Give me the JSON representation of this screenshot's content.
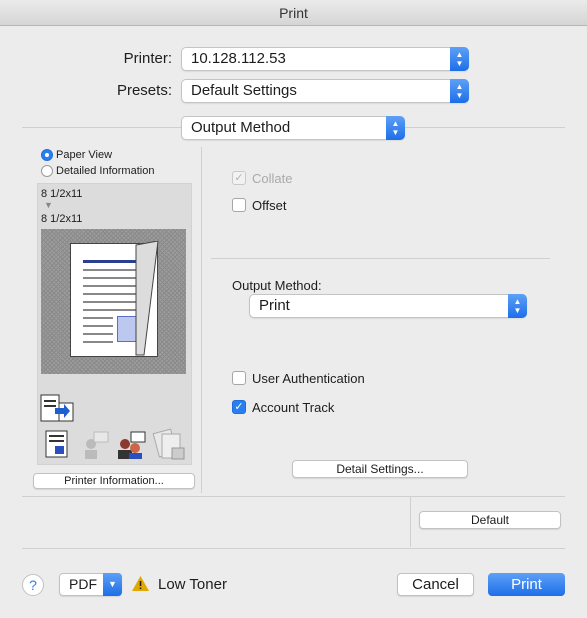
{
  "window": {
    "title": "Print"
  },
  "printer": {
    "label": "Printer:",
    "value": "10.128.112.53"
  },
  "presets": {
    "label": "Presets:",
    "value": "Default Settings"
  },
  "section": {
    "value": "Output Method"
  },
  "view": {
    "paper_view": "Paper View",
    "detailed_info": "Detailed Information",
    "paper_size_1": "8 1/2x11",
    "paper_size_2": "8 1/2x11",
    "printer_info_button": "Printer Information..."
  },
  "options": {
    "collate": "Collate",
    "offset": "Offset",
    "output_method_label": "Output Method:",
    "output_method_value": "Print",
    "user_auth": "User Authentication",
    "account_track": "Account Track",
    "detail_settings": "Detail Settings...",
    "default_button": "Default"
  },
  "footer": {
    "help": "?",
    "pdf": "PDF",
    "warning": "Low Toner",
    "cancel": "Cancel",
    "print": "Print"
  },
  "colors": {
    "accent": "#2a7ff0",
    "warning": "#e0a800"
  }
}
